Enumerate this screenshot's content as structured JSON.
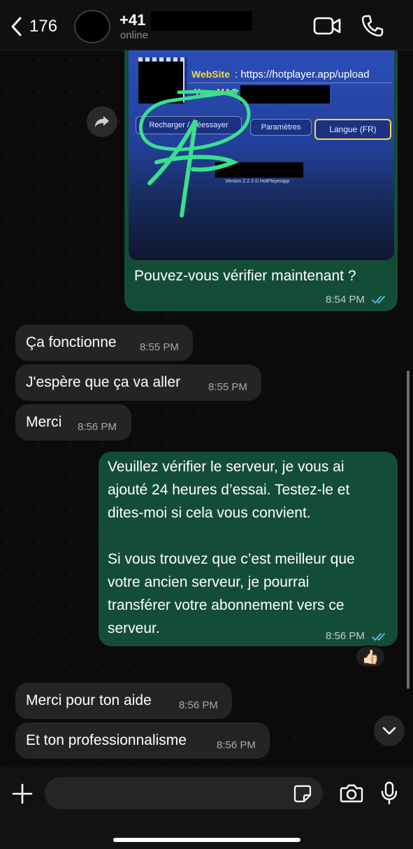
{
  "header": {
    "back_count": "176",
    "contact_name": "+41",
    "status": "online"
  },
  "photo": {
    "website_label": "WebSite",
    "website_value": ": https://hotplayer.app/upload",
    "mac_label": "Your MAC",
    "btn_reload": "Recharger / Réessayer",
    "btn_settings": "Paramètres",
    "btn_language": "Langue (FR)",
    "version": "Version 2.2.3 © HotPlayerapp"
  },
  "messages": [
    {
      "id": "m1",
      "dir": "out",
      "text": "Pouvez-vous vérifier maintenant ?",
      "time": "8:54 PM",
      "read": true
    },
    {
      "id": "m2",
      "dir": "in",
      "text": "Ça fonctionne",
      "time": "8:55 PM"
    },
    {
      "id": "m3",
      "dir": "in",
      "text": "J'espère que ça va aller",
      "time": "8:55 PM"
    },
    {
      "id": "m4",
      "dir": "in",
      "text": "Merci",
      "time": "8:56 PM"
    },
    {
      "id": "m5",
      "dir": "out",
      "lines": [
        "Veuillez vérifier le serveur, je vous ai",
        "ajouté 24 heures d’essai. Testez-le et",
        "dites-moi si cela vous convient.",
        "",
        "Si vous trouvez que c’est meilleur que",
        "votre ancien serveur, je pourrai",
        "transférer votre abonnement vers ce",
        "serveur."
      ],
      "time": "8:56 PM",
      "read": true,
      "reaction": "👍🏻"
    },
    {
      "id": "m6",
      "dir": "in",
      "text": "Merci pour ton aide",
      "time": "8:56 PM"
    },
    {
      "id": "m7",
      "dir": "in",
      "text": "Et ton professionnalisme",
      "time": "8:56 PM"
    }
  ],
  "composer": {
    "value": "",
    "placeholder": ""
  },
  "colors": {
    "outgoing_bubble": "#144d37",
    "incoming_bubble": "#242424",
    "read_ticks": "#53bdeb",
    "background": "#0b0b0b"
  },
  "icons": [
    "chevron-left-icon",
    "video-call-icon",
    "phone-icon",
    "forward-icon",
    "plus-icon",
    "sticker-icon",
    "camera-icon",
    "microphone-icon",
    "chevron-down-icon",
    "double-check-icon"
  ]
}
